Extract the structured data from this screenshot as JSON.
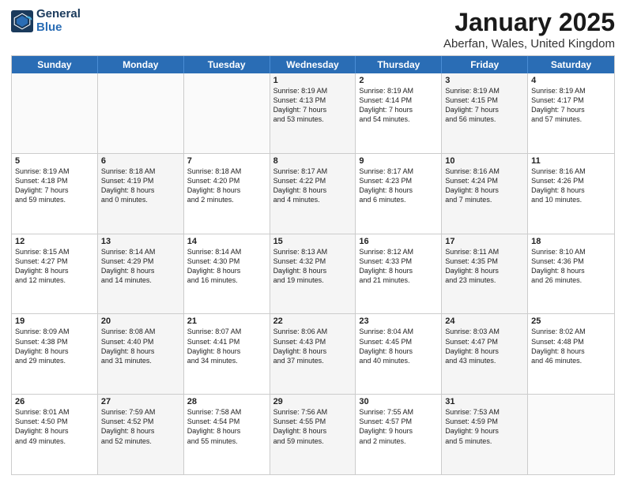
{
  "header": {
    "logo_line1": "General",
    "logo_line2": "Blue",
    "main_title": "January 2025",
    "subtitle": "Aberfan, Wales, United Kingdom"
  },
  "days_of_week": [
    "Sunday",
    "Monday",
    "Tuesday",
    "Wednesday",
    "Thursday",
    "Friday",
    "Saturday"
  ],
  "weeks": [
    [
      {
        "day": "",
        "text": "",
        "empty": true
      },
      {
        "day": "",
        "text": "",
        "empty": true
      },
      {
        "day": "",
        "text": "",
        "empty": true
      },
      {
        "day": "1",
        "text": "Sunrise: 8:19 AM\nSunset: 4:13 PM\nDaylight: 7 hours\nand 53 minutes."
      },
      {
        "day": "2",
        "text": "Sunrise: 8:19 AM\nSunset: 4:14 PM\nDaylight: 7 hours\nand 54 minutes."
      },
      {
        "day": "3",
        "text": "Sunrise: 8:19 AM\nSunset: 4:15 PM\nDaylight: 7 hours\nand 56 minutes."
      },
      {
        "day": "4",
        "text": "Sunrise: 8:19 AM\nSunset: 4:17 PM\nDaylight: 7 hours\nand 57 minutes."
      }
    ],
    [
      {
        "day": "5",
        "text": "Sunrise: 8:19 AM\nSunset: 4:18 PM\nDaylight: 7 hours\nand 59 minutes."
      },
      {
        "day": "6",
        "text": "Sunrise: 8:18 AM\nSunset: 4:19 PM\nDaylight: 8 hours\nand 0 minutes."
      },
      {
        "day": "7",
        "text": "Sunrise: 8:18 AM\nSunset: 4:20 PM\nDaylight: 8 hours\nand 2 minutes."
      },
      {
        "day": "8",
        "text": "Sunrise: 8:17 AM\nSunset: 4:22 PM\nDaylight: 8 hours\nand 4 minutes."
      },
      {
        "day": "9",
        "text": "Sunrise: 8:17 AM\nSunset: 4:23 PM\nDaylight: 8 hours\nand 6 minutes."
      },
      {
        "day": "10",
        "text": "Sunrise: 8:16 AM\nSunset: 4:24 PM\nDaylight: 8 hours\nand 7 minutes."
      },
      {
        "day": "11",
        "text": "Sunrise: 8:16 AM\nSunset: 4:26 PM\nDaylight: 8 hours\nand 10 minutes."
      }
    ],
    [
      {
        "day": "12",
        "text": "Sunrise: 8:15 AM\nSunset: 4:27 PM\nDaylight: 8 hours\nand 12 minutes."
      },
      {
        "day": "13",
        "text": "Sunrise: 8:14 AM\nSunset: 4:29 PM\nDaylight: 8 hours\nand 14 minutes."
      },
      {
        "day": "14",
        "text": "Sunrise: 8:14 AM\nSunset: 4:30 PM\nDaylight: 8 hours\nand 16 minutes."
      },
      {
        "day": "15",
        "text": "Sunrise: 8:13 AM\nSunset: 4:32 PM\nDaylight: 8 hours\nand 19 minutes."
      },
      {
        "day": "16",
        "text": "Sunrise: 8:12 AM\nSunset: 4:33 PM\nDaylight: 8 hours\nand 21 minutes."
      },
      {
        "day": "17",
        "text": "Sunrise: 8:11 AM\nSunset: 4:35 PM\nDaylight: 8 hours\nand 23 minutes."
      },
      {
        "day": "18",
        "text": "Sunrise: 8:10 AM\nSunset: 4:36 PM\nDaylight: 8 hours\nand 26 minutes."
      }
    ],
    [
      {
        "day": "19",
        "text": "Sunrise: 8:09 AM\nSunset: 4:38 PM\nDaylight: 8 hours\nand 29 minutes."
      },
      {
        "day": "20",
        "text": "Sunrise: 8:08 AM\nSunset: 4:40 PM\nDaylight: 8 hours\nand 31 minutes."
      },
      {
        "day": "21",
        "text": "Sunrise: 8:07 AM\nSunset: 4:41 PM\nDaylight: 8 hours\nand 34 minutes."
      },
      {
        "day": "22",
        "text": "Sunrise: 8:06 AM\nSunset: 4:43 PM\nDaylight: 8 hours\nand 37 minutes."
      },
      {
        "day": "23",
        "text": "Sunrise: 8:04 AM\nSunset: 4:45 PM\nDaylight: 8 hours\nand 40 minutes."
      },
      {
        "day": "24",
        "text": "Sunrise: 8:03 AM\nSunset: 4:47 PM\nDaylight: 8 hours\nand 43 minutes."
      },
      {
        "day": "25",
        "text": "Sunrise: 8:02 AM\nSunset: 4:48 PM\nDaylight: 8 hours\nand 46 minutes."
      }
    ],
    [
      {
        "day": "26",
        "text": "Sunrise: 8:01 AM\nSunset: 4:50 PM\nDaylight: 8 hours\nand 49 minutes."
      },
      {
        "day": "27",
        "text": "Sunrise: 7:59 AM\nSunset: 4:52 PM\nDaylight: 8 hours\nand 52 minutes."
      },
      {
        "day": "28",
        "text": "Sunrise: 7:58 AM\nSunset: 4:54 PM\nDaylight: 8 hours\nand 55 minutes."
      },
      {
        "day": "29",
        "text": "Sunrise: 7:56 AM\nSunset: 4:55 PM\nDaylight: 8 hours\nand 59 minutes."
      },
      {
        "day": "30",
        "text": "Sunrise: 7:55 AM\nSunset: 4:57 PM\nDaylight: 9 hours\nand 2 minutes."
      },
      {
        "day": "31",
        "text": "Sunrise: 7:53 AM\nSunset: 4:59 PM\nDaylight: 9 hours\nand 5 minutes."
      },
      {
        "day": "",
        "text": "",
        "empty": true
      }
    ]
  ]
}
